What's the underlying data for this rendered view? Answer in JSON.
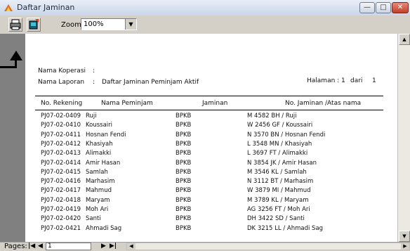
{
  "window": {
    "title": "Daftar Jaminan"
  },
  "toolbar": {
    "zoom_label": "Zoom",
    "zoom_value": "100%"
  },
  "report": {
    "koperasi_label": "Nama Koperasi",
    "koperasi_colon": ":",
    "koperasi_value": "",
    "laporan_label": "Nama Laporan",
    "laporan_colon": ":",
    "laporan_value": "Daftar Jaminan Peminjam Aktif",
    "halaman_label": "Halaman :",
    "halaman_current": "1",
    "halaman_of": "dari",
    "halaman_total": "1",
    "columns": [
      "No. Rekening",
      "Nama Peminjam",
      "Jaminan",
      "No. Jaminan /Atas nama"
    ],
    "rows": [
      [
        "PJ07-02-0409",
        "Ruji",
        "BPKB",
        "M 4582 BH / Ruji"
      ],
      [
        "PJ07-02-0410",
        "Koussairi",
        "BPKB",
        "W 2456 GF / Koussairi"
      ],
      [
        "PJ07-02-0411",
        "Hosnan Fendi",
        "BPKB",
        "N 3570 BN / Hosnan Fendi"
      ],
      [
        "PJ07-02-0412",
        "Khasiyah",
        "BPKB",
        "L 3548 MN / Khasiyah"
      ],
      [
        "PJ07-02-0413",
        "Alimakki",
        "BPKB",
        "L 3697 FT / Alimakki"
      ],
      [
        "PJ07-02-0414",
        "Amir Hasan",
        "BPKB",
        "N 3854 JK / Amir Hasan"
      ],
      [
        "PJ07-02-0415",
        "Samlah",
        "BPKB",
        "M 3546 KL / Samlah"
      ],
      [
        "PJ07-02-0416",
        "Marhasim",
        "BPKB",
        "N 3112 BT / Marhasim"
      ],
      [
        "PJ07-02-0417",
        "Mahmud",
        "BPKB",
        "W 3879 MI / Mahmud"
      ],
      [
        "PJ07-02-0418",
        "Maryam",
        "BPKB",
        "M 3789 KL / Maryam"
      ],
      [
        "PJ07-02-0419",
        "Moh Ari",
        "BPKB",
        "AG 3256 FT / Moh Ari"
      ],
      [
        "PJ07-02-0420",
        "Santi",
        "BPKB",
        "DH 3422 SD / Santi"
      ],
      [
        "PJ07-02-0421",
        "Ahmadi Sag",
        "BPKB",
        "DK 3215 LL / Ahmadi Sag"
      ]
    ]
  },
  "statusbar": {
    "pages_label": "Pages:",
    "page_value": "1"
  },
  "colors": {
    "titlebar": "#c9d6ea",
    "close": "#c0402a",
    "page": "#ffffff",
    "chrome": "#d4d0c8"
  },
  "icons": [
    "app-icon",
    "minimize-icon",
    "maximize-icon",
    "close-icon",
    "print-icon",
    "export-icon",
    "dropdown-icon",
    "first-page-icon",
    "prev-page-icon",
    "next-page-icon",
    "last-page-icon"
  ]
}
